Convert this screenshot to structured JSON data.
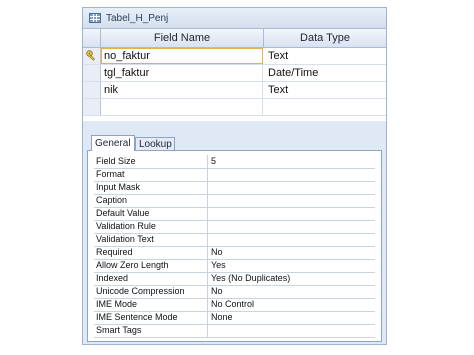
{
  "window": {
    "title": "Tabel_H_Penj",
    "title_icon": "table-icon"
  },
  "grid": {
    "headers": {
      "field_name": "Field Name",
      "data_type": "Data Type"
    },
    "rows": [
      {
        "field_name": "no_faktur",
        "data_type": "Text",
        "primary_key": true
      },
      {
        "field_name": "tgl_faktur",
        "data_type": "Date/Time"
      },
      {
        "field_name": "nik",
        "data_type": "Text"
      },
      {
        "field_name": "",
        "data_type": ""
      }
    ]
  },
  "properties": {
    "tabs": [
      "General",
      "Lookup"
    ],
    "active_tab": "General",
    "rows": [
      {
        "label": "Field Size",
        "value": "5"
      },
      {
        "label": "Format",
        "value": ""
      },
      {
        "label": "Input Mask",
        "value": ""
      },
      {
        "label": "Caption",
        "value": ""
      },
      {
        "label": "Default Value",
        "value": ""
      },
      {
        "label": "Validation Rule",
        "value": ""
      },
      {
        "label": "Validation Text",
        "value": ""
      },
      {
        "label": "Required",
        "value": "No"
      },
      {
        "label": "Allow Zero Length",
        "value": "Yes"
      },
      {
        "label": "Indexed",
        "value": "Yes (No Duplicates)"
      },
      {
        "label": "Unicode Compression",
        "value": "No"
      },
      {
        "label": "IME Mode",
        "value": "No Control"
      },
      {
        "label": "IME Sentence Mode",
        "value": "None"
      },
      {
        "label": "Smart Tags",
        "value": ""
      }
    ]
  }
}
